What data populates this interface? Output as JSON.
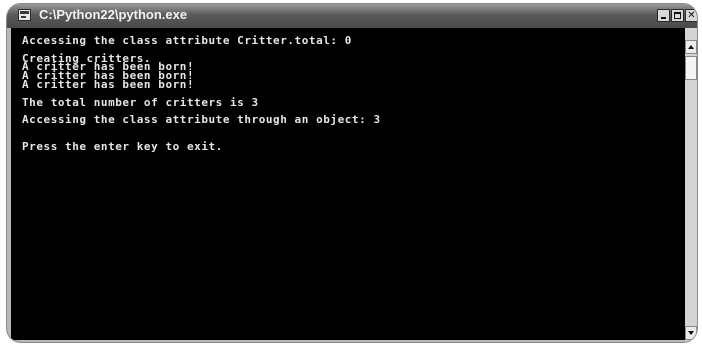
{
  "window": {
    "title": "C:\\Python22\\python.exe",
    "controls": {
      "minimize_icon": "minimize-icon",
      "maximize_icon": "maximize-icon",
      "close_icon": "close-icon",
      "close_glyph": "✕"
    }
  },
  "console": {
    "lines": [
      "Accessing the class attribute Critter.total: 0",
      "",
      "Creating critters.",
      "A critter has been born!",
      "A critter has been born!",
      "A critter has been born!",
      "",
      "The total number of critters is 3",
      "",
      "Accessing the class attribute through an object: 3",
      "",
      "",
      "Press the enter key to exit."
    ]
  },
  "colors": {
    "console_background": "#000000",
    "console_text": "#e6e6e6",
    "titlebar": "#4a4a4a"
  }
}
